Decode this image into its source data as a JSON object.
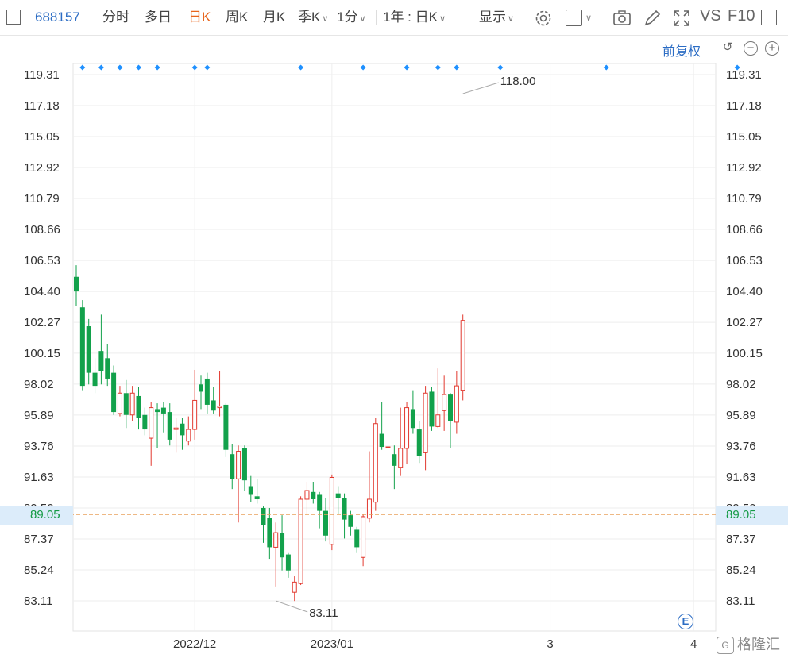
{
  "toolbar": {
    "code": "688157",
    "items": [
      {
        "label": "分时"
      },
      {
        "label": "多日"
      },
      {
        "label": "日K",
        "active": true
      },
      {
        "label": "周K"
      },
      {
        "label": "月K"
      },
      {
        "label": "季K"
      },
      {
        "label": "1分"
      },
      {
        "label": "1年 : 日K"
      },
      {
        "label": "显示"
      }
    ],
    "vs_label": "VS",
    "f10_label": "F10"
  },
  "adjust_label": "前复权",
  "ctrl_minus": "−",
  "ctrl_plus": "+",
  "current_price": "89.05",
  "e_badge": "E",
  "watermark": "格隆汇",
  "watermark_logo": "G",
  "colors": {
    "up": "#e2392f",
    "down": "#12a14b",
    "grid": "#eeeeee",
    "accent": "#2b6cc4",
    "marker": "#1e90ff",
    "price_line": "#e8a05b"
  },
  "chart_data": {
    "type": "candlestick",
    "ylim": [
      81.5,
      120.8
    ],
    "y_ticks": [
      119.31,
      117.18,
      115.05,
      112.92,
      110.79,
      108.66,
      106.53,
      104.4,
      102.27,
      100.15,
      98.02,
      95.89,
      93.76,
      91.63,
      89.5,
      87.37,
      85.24,
      83.11
    ],
    "x_labels": [
      "2022/12",
      "2023/01",
      "3",
      "4"
    ],
    "x_label_index": [
      19,
      41,
      76,
      99
    ],
    "high_annotation": {
      "index": 62,
      "value": 118.0,
      "label": "118.00"
    },
    "low_annotation": {
      "index": 32,
      "value": 83.11,
      "label": "83.11"
    },
    "current_price": 89.05,
    "event_marker_index": [
      1,
      4,
      7,
      10,
      13,
      19,
      21,
      36,
      46,
      53,
      58,
      61,
      68,
      85,
      106
    ],
    "candles": [
      [
        105.4,
        104.4,
        106.2,
        103.4
      ],
      [
        103.3,
        97.9,
        103.8,
        97.6
      ],
      [
        102.0,
        98.8,
        102.5,
        98.0
      ],
      [
        98.8,
        97.9,
        99.8,
        97.4
      ],
      [
        100.3,
        98.9,
        102.8,
        98.0
      ],
      [
        99.8,
        98.4,
        100.8,
        97.9
      ],
      [
        98.8,
        96.1,
        99.3,
        95.9
      ],
      [
        96.0,
        97.4,
        97.9,
        95.8
      ],
      [
        97.4,
        95.9,
        98.3,
        95.0
      ],
      [
        95.9,
        97.4,
        97.9,
        95.5
      ],
      [
        97.2,
        95.7,
        97.8,
        94.9
      ],
      [
        95.9,
        94.9,
        96.4,
        94.5
      ],
      [
        94.3,
        96.4,
        96.8,
        92.4
      ],
      [
        96.3,
        96.1,
        96.7,
        93.6
      ],
      [
        96.4,
        96.0,
        96.8,
        94.7
      ],
      [
        96.1,
        94.2,
        96.7,
        93.8
      ],
      [
        94.9,
        95.0,
        95.7,
        93.3
      ],
      [
        95.3,
        94.5,
        95.7,
        93.5
      ],
      [
        94.1,
        94.9,
        95.8,
        93.8
      ],
      [
        94.9,
        96.9,
        99.0,
        94.2
      ],
      [
        98.0,
        97.5,
        98.6,
        96.3
      ],
      [
        98.4,
        96.6,
        98.8,
        96.0
      ],
      [
        96.9,
        96.2,
        97.8,
        96.0
      ],
      [
        96.4,
        96.5,
        98.9,
        95.8
      ],
      [
        96.6,
        93.5,
        96.7,
        93.0
      ],
      [
        93.2,
        91.5,
        93.9,
        90.8
      ],
      [
        91.5,
        93.4,
        93.8,
        88.5
      ],
      [
        93.6,
        91.4,
        93.8,
        90.7
      ],
      [
        91.0,
        90.4,
        91.7,
        89.9
      ],
      [
        90.3,
        90.1,
        91.5,
        89.8
      ],
      [
        89.5,
        88.3,
        89.6,
        87.1
      ],
      [
        88.8,
        86.8,
        89.5,
        86.0
      ],
      [
        86.8,
        87.8,
        88.5,
        84.1
      ],
      [
        87.8,
        86.1,
        89.0,
        85.2
      ],
      [
        86.3,
        85.2,
        86.4,
        84.7
      ],
      [
        83.7,
        84.4,
        84.8,
        83.1
      ],
      [
        84.3,
        90.1,
        90.3,
        84.2
      ],
      [
        90.1,
        90.7,
        91.3,
        89.0
      ],
      [
        90.6,
        90.1,
        91.3,
        89.8
      ],
      [
        90.4,
        89.3,
        90.6,
        88.1
      ],
      [
        89.3,
        87.6,
        90.2,
        87.2
      ],
      [
        87.0,
        91.6,
        91.8,
        86.6
      ],
      [
        90.5,
        90.2,
        91.0,
        89.1
      ],
      [
        90.2,
        88.7,
        90.5,
        87.4
      ],
      [
        89.0,
        88.2,
        89.3,
        87.6
      ],
      [
        88.0,
        86.8,
        88.2,
        86.4
      ],
      [
        86.1,
        88.9,
        89.1,
        85.5
      ],
      [
        88.8,
        90.1,
        93.4,
        88.5
      ],
      [
        89.9,
        95.3,
        95.7,
        89.3
      ],
      [
        94.6,
        93.7,
        96.8,
        93.5
      ],
      [
        93.7,
        93.7,
        96.3,
        92.9
      ],
      [
        93.2,
        92.4,
        93.8,
        90.8
      ],
      [
        92.3,
        93.6,
        96.4,
        91.7
      ],
      [
        93.6,
        96.4,
        96.8,
        92.5
      ],
      [
        96.3,
        95.0,
        97.6,
        94.6
      ],
      [
        94.9,
        93.1,
        95.5,
        92.6
      ],
      [
        93.3,
        97.4,
        97.9,
        92.1
      ],
      [
        97.5,
        95.1,
        97.8,
        94.8
      ],
      [
        95.1,
        95.9,
        99.1,
        95.0
      ],
      [
        96.2,
        97.3,
        98.6,
        94.8
      ],
      [
        97.3,
        95.5,
        97.4,
        93.6
      ],
      [
        95.4,
        97.9,
        98.9,
        94.6
      ],
      [
        97.6,
        102.4,
        102.8,
        96.9
      ]
    ]
  }
}
